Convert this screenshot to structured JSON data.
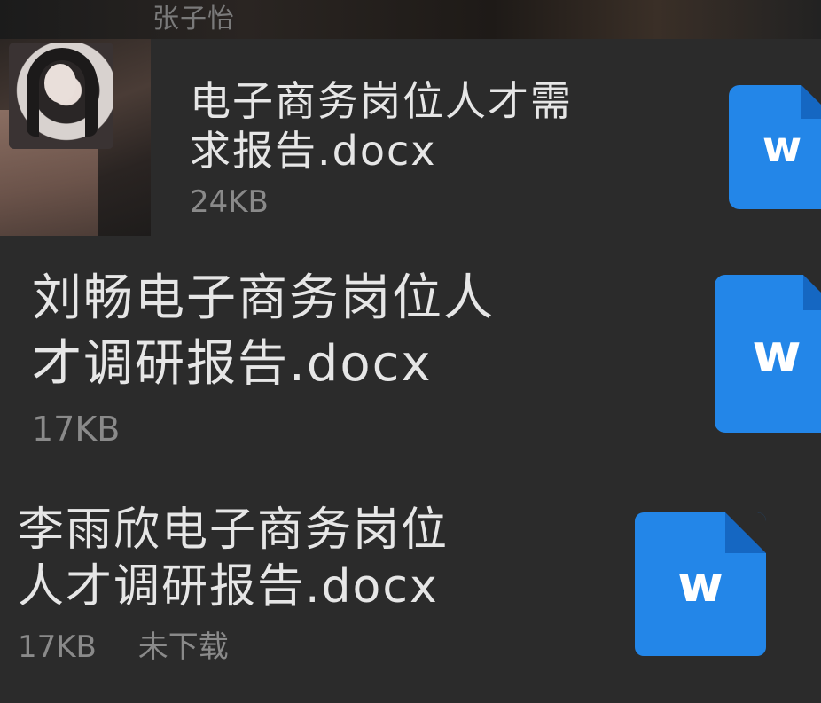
{
  "chat": {
    "sender_name": "张子怡"
  },
  "files": [
    {
      "name": "电子商务岗位人才需\n求报告.docx",
      "size": "24KB",
      "status": "",
      "icon": "word-doc-icon",
      "icon_letter": "w"
    },
    {
      "name": "刘畅电子商务岗位人\n才调研报告.docx",
      "size": "17KB",
      "status": "",
      "icon": "word-doc-icon",
      "icon_letter": "w"
    },
    {
      "name": "李雨欣电子商务岗位\n人才调研报告.docx",
      "size": "17KB",
      "status": "未下载",
      "icon": "word-doc-icon",
      "icon_letter": "w"
    }
  ],
  "colors": {
    "background": "#2b2b2b",
    "word_blue": "#2386e8",
    "text_primary": "#e6e6e6",
    "text_secondary": "#8a8a8a"
  }
}
